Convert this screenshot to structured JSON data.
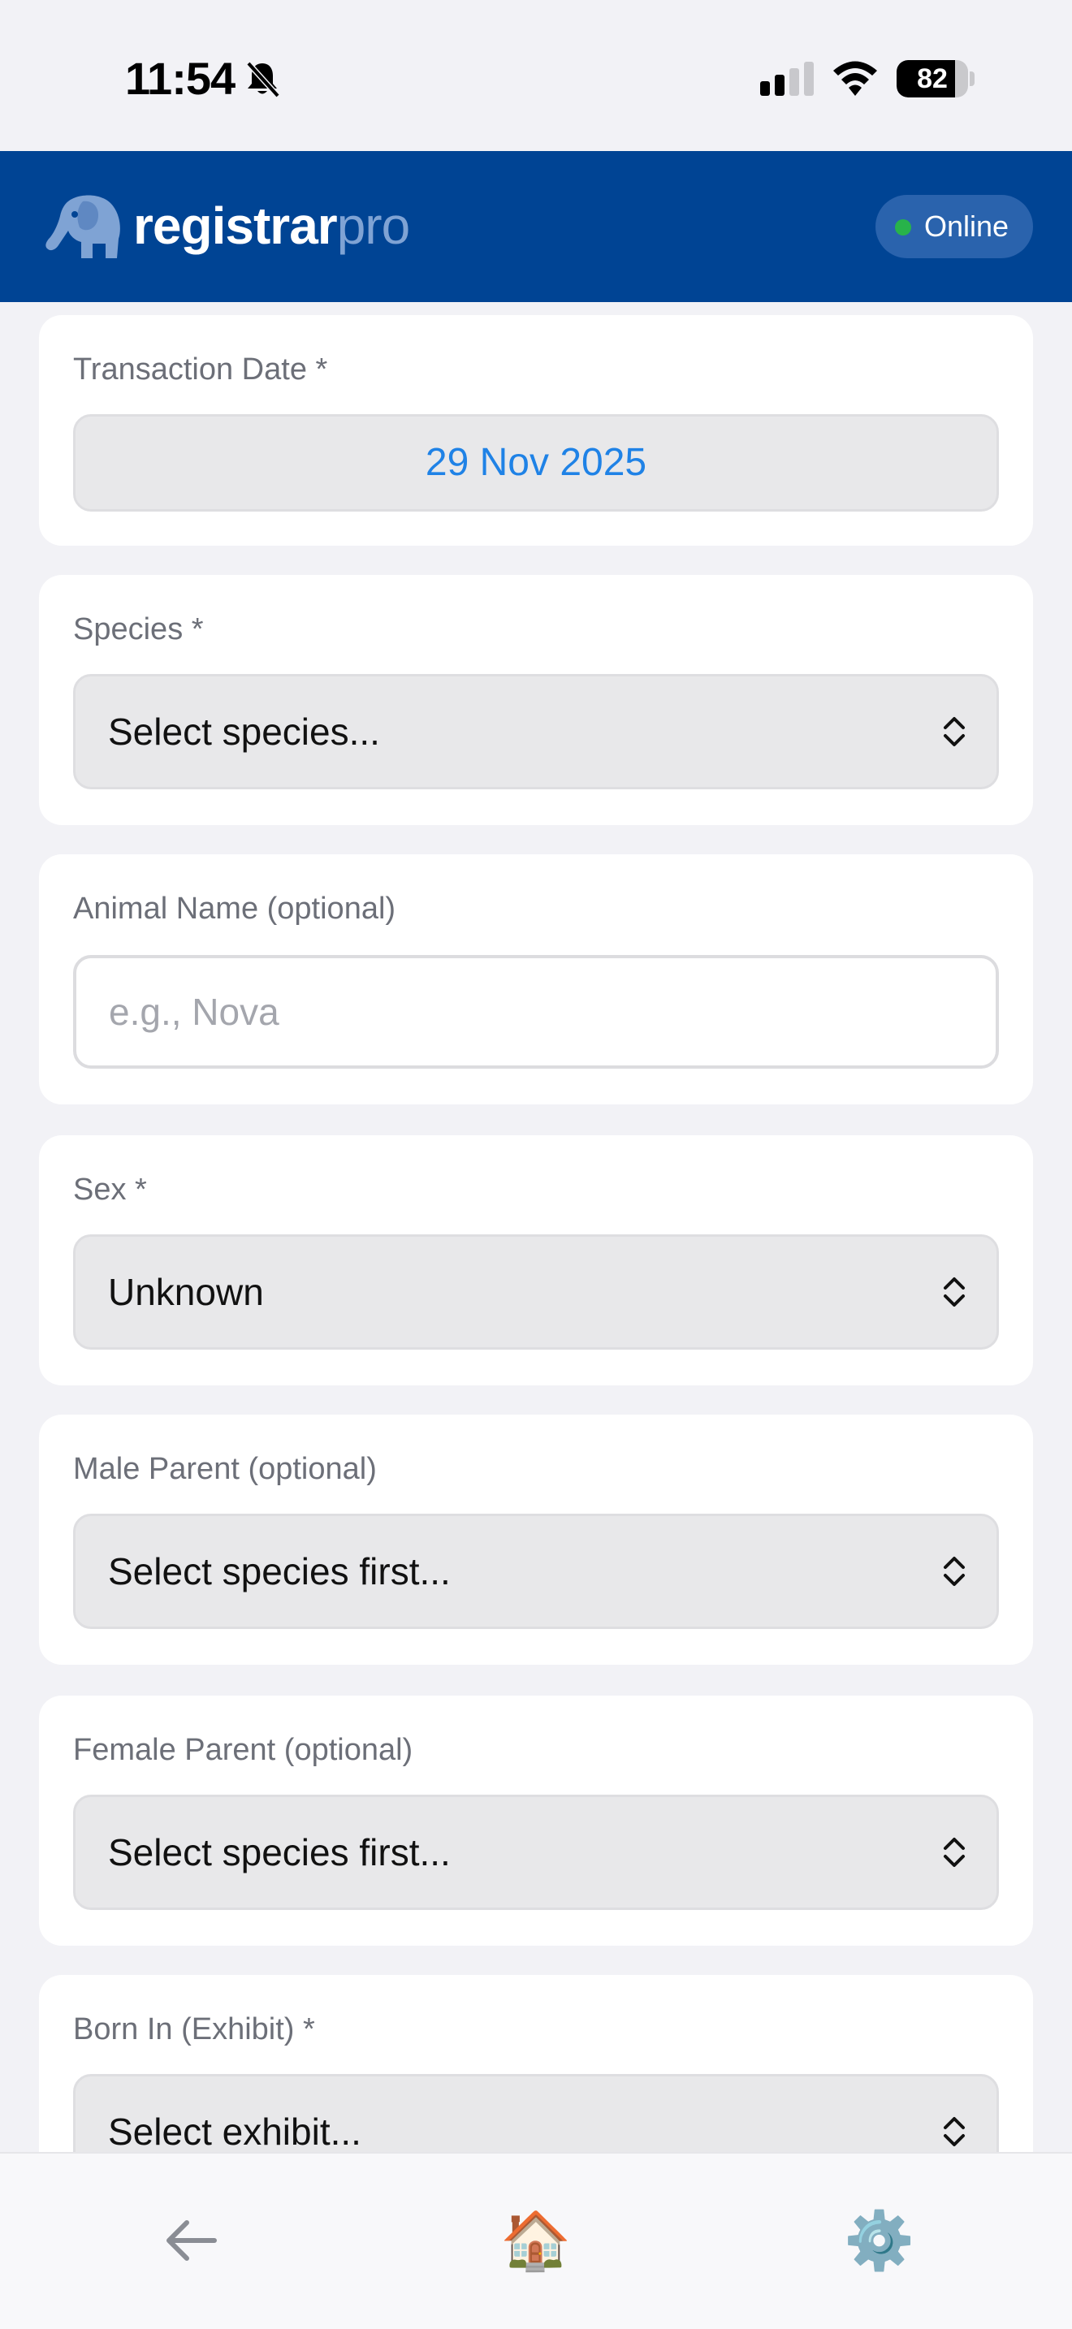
{
  "status_bar": {
    "time": "11:54",
    "battery": "82",
    "battery_fraction": 0.82
  },
  "header": {
    "brand_part1": "registrar",
    "brand_part2": "pro",
    "status": "Online"
  },
  "form": {
    "transaction_date": {
      "label": "Transaction Date *",
      "value": "29 Nov 2025"
    },
    "species": {
      "label": "Species *",
      "value": "Select species..."
    },
    "animal_name": {
      "label": "Animal Name (optional)",
      "placeholder": "e.g., Nova"
    },
    "sex": {
      "label": "Sex *",
      "value": "Unknown"
    },
    "male_parent": {
      "label": "Male Parent (optional)",
      "value": "Select species first..."
    },
    "female_parent": {
      "label": "Female Parent (optional)",
      "value": "Select species first..."
    },
    "born_in": {
      "label": "Born In (Exhibit) *",
      "value": "Select exhibit..."
    }
  },
  "bottom_nav": {
    "back_icon": "←",
    "home_icon": "🏠",
    "settings_icon": "⚙️"
  },
  "colors": {
    "header_bg": "#004494",
    "accent": "#1f82e6",
    "online_dot": "#28b34a"
  }
}
